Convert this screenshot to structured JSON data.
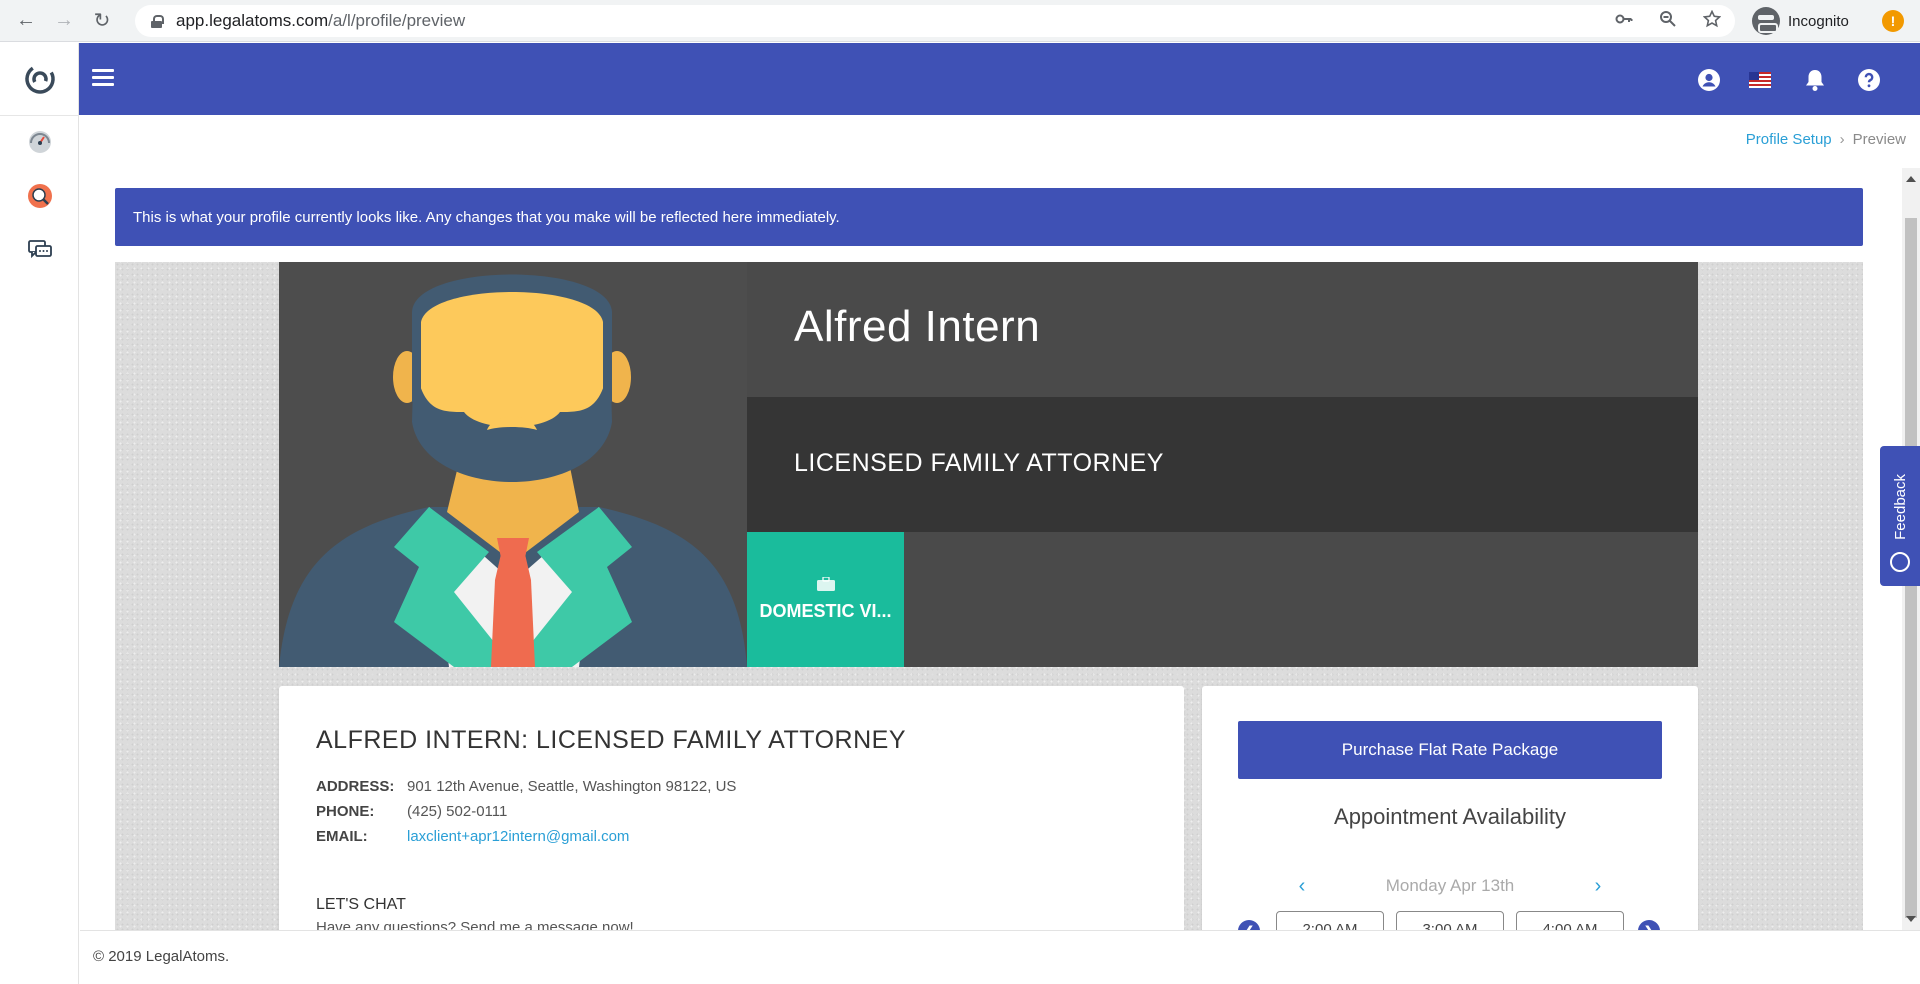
{
  "browser": {
    "url_host": "app.legalatoms.com",
    "url_path": "/a/l/profile/preview",
    "profile_label": "Incognito",
    "update_badge": "!"
  },
  "breadcrumb": {
    "items": [
      {
        "label": "Profile Setup"
      },
      {
        "label": "Preview"
      }
    ],
    "separator": "›"
  },
  "banner": {
    "text": "This is what your profile currently looks like. Any changes that you make will be reflected here immediately."
  },
  "profile": {
    "name": "Alfred Intern",
    "title": "LICENSED FAMILY ATTORNEY",
    "practice_area": "DOMESTIC VI...",
    "heading": "ALFRED INTERN: LICENSED FAMILY ATTORNEY",
    "details": [
      {
        "key": "ADDRESS:",
        "value": "901 12th Avenue, Seattle, Washington 98122, US"
      },
      {
        "key": "PHONE:",
        "value": "(425) 502-0111"
      },
      {
        "key": "EMAIL:",
        "value": "laxclient+apr12intern@gmail.com"
      }
    ],
    "chat_heading": "LET'S CHAT",
    "chat_text": "Have any questions? Send me a message now!"
  },
  "booking": {
    "purchase_label": "Purchase Flat Rate Package",
    "availability_title": "Appointment Availability",
    "date_label": "Monday Apr 13th",
    "slots": [
      "2:00 AM",
      "3:00 AM",
      "4:00 AM"
    ]
  },
  "feedback": {
    "label": "Feedback"
  },
  "footer": {
    "text": "© 2019 LegalAtoms."
  },
  "colors": {
    "primary": "#3f51b5",
    "practice_tile": "#1abc9c",
    "link": "#2a9fd6"
  }
}
